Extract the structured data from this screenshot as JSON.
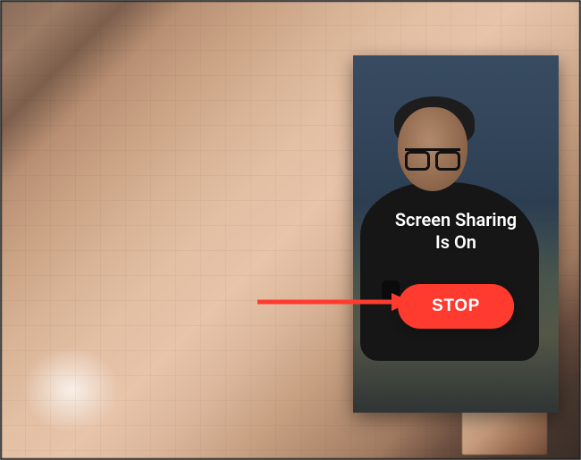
{
  "pip": {
    "status_text": "Screen Sharing\nIs On",
    "stop_label": "STOP"
  },
  "annotation": {
    "arrow_color": "#ff3b2f"
  }
}
